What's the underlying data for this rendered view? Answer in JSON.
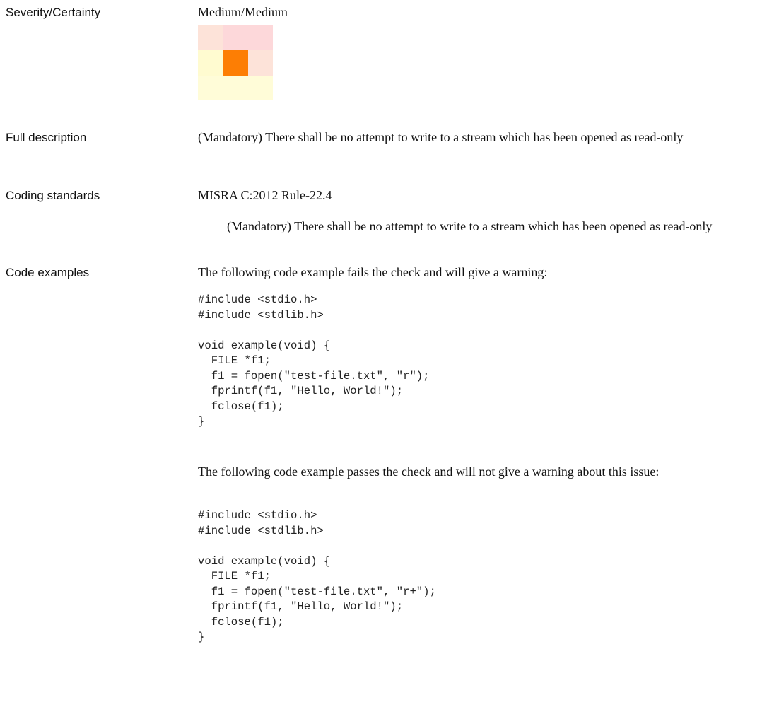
{
  "rows": {
    "severity": {
      "label": "Severity/Certainty",
      "value": "Medium/Medium"
    },
    "full_description": {
      "label": "Full description",
      "text": "(Mandatory) There shall be no attempt to write to a stream which has been opened as read-only"
    },
    "coding_standards": {
      "label": "Coding standards",
      "standard": "MISRA C:2012 Rule-22.4",
      "standard_text": "(Mandatory) There shall be no attempt to write to a stream which has been opened as read-only"
    },
    "code_examples": {
      "label": "Code examples",
      "fail_intro": "The following code example fails the check and will give a warning:",
      "fail_code": "#include <stdio.h>\n#include <stdlib.h>\n\nvoid example(void) {\n  FILE *f1;\n  f1 = fopen(\"test-file.txt\", \"r\");\n  fprintf(f1, \"Hello, World!\");\n  fclose(f1);\n}",
      "pass_intro": "The following code example passes the check and will not give a warning about this issue:",
      "pass_code": "#include <stdio.h>\n#include <stdlib.h>\n\nvoid example(void) {\n  FILE *f1;\n  f1 = fopen(\"test-file.txt\", \"r+\");\n  fprintf(f1, \"Hello, World!\");\n  fclose(f1);\n}"
    }
  },
  "severity_matrix": {
    "highlighted_cell": "middle-center",
    "colors": [
      [
        "#fde3d9",
        "#fdd8da",
        "#fdd8da"
      ],
      [
        "#fffbd0",
        "#fd7e04",
        "#fde3d9"
      ],
      [
        "#fffcd8",
        "#fffcd8",
        "#fffcd8"
      ]
    ]
  }
}
